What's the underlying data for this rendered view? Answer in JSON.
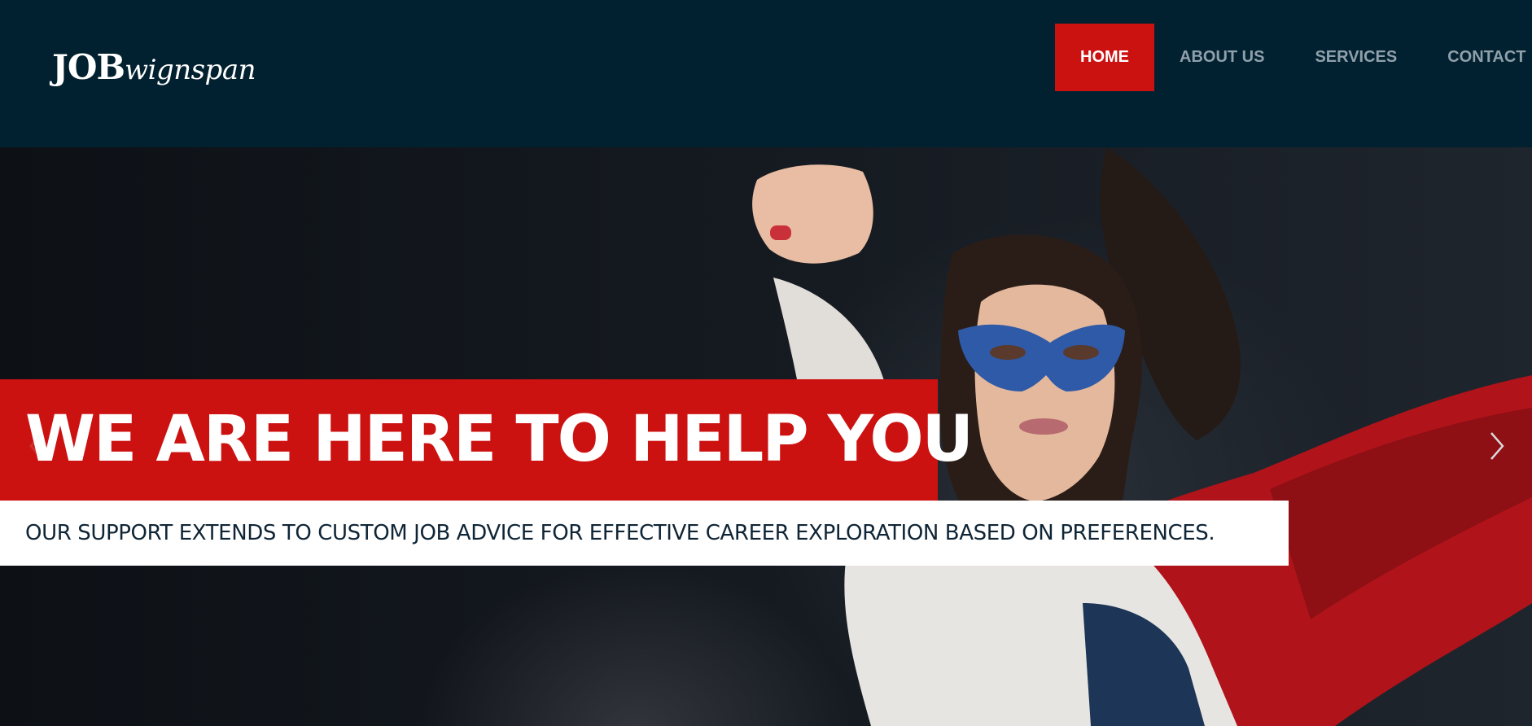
{
  "header": {
    "logo": {
      "strong": "JOB",
      "script": "wignspan"
    },
    "nav": [
      {
        "label": "HOME",
        "active": true
      },
      {
        "label": "ABOUT US",
        "active": false
      },
      {
        "label": "SERVICES",
        "active": false
      },
      {
        "label": "CONTACT",
        "active": false
      }
    ]
  },
  "hero": {
    "headline": "WE ARE HERE TO HELP YOU",
    "subtitle": "OUR SUPPORT EXTENDS TO CUSTOM JOB ADVICE FOR EFFECTIVE CAREER EXPLORATION BASED ON PREFERENCES.",
    "image_icon": "superhero-woman-photo",
    "prev_icon": "chevron-left-icon",
    "next_icon": "chevron-right-icon"
  },
  "colors": {
    "header_bg": "#022130",
    "accent": "#cc1111",
    "nav_text": "#8fa0ab",
    "subtitle_text": "#0f2536"
  }
}
